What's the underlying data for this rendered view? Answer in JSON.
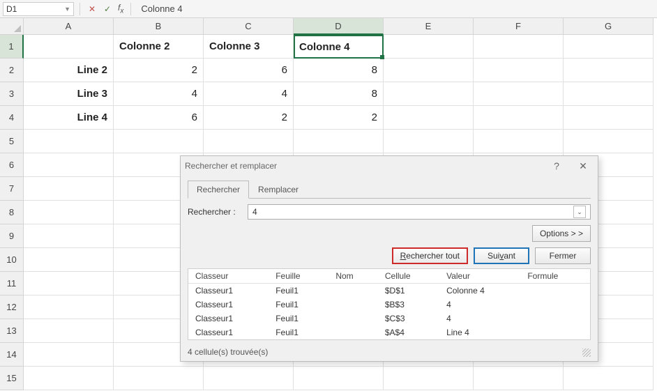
{
  "formula_bar": {
    "name_box": "D1",
    "formula": "Colonne 4"
  },
  "columns": [
    "A",
    "B",
    "C",
    "D",
    "E",
    "F",
    "G"
  ],
  "rows": [
    "1",
    "2",
    "3",
    "4",
    "5",
    "6",
    "7",
    "8",
    "9",
    "10",
    "11",
    "12",
    "13",
    "14",
    "15"
  ],
  "active": {
    "col": "D",
    "row": "1"
  },
  "sheet": {
    "r1": {
      "A": "",
      "B": "Colonne 2",
      "C": "Colonne 3",
      "D": "Colonne 4"
    },
    "r2": {
      "A": "Line 2",
      "B": "2",
      "C": "6",
      "D": "8"
    },
    "r3": {
      "A": "Line 3",
      "B": "4",
      "C": "4",
      "D": "8"
    },
    "r4": {
      "A": "Line 4",
      "B": "6",
      "C": "2",
      "D": "2"
    }
  },
  "dialog": {
    "title": "Rechercher et remplacer",
    "help": "?",
    "close": "✕",
    "tabs": {
      "find": "Rechercher",
      "replace": "Remplacer"
    },
    "label_find": "Rechercher :",
    "find_value": "4",
    "options_btn": "Options > >",
    "btn_find_all": "Rechercher tout",
    "btn_find_next": "Suivant",
    "btn_close": "Fermer",
    "results": {
      "headers": {
        "workbook": "Classeur",
        "sheet": "Feuille",
        "name": "Nom",
        "cell": "Cellule",
        "value": "Valeur",
        "formula": "Formule"
      },
      "rows": [
        {
          "workbook": "Classeur1",
          "sheet": "Feuil1",
          "name": "",
          "cell": "$D$1",
          "value": "Colonne 4",
          "formula": ""
        },
        {
          "workbook": "Classeur1",
          "sheet": "Feuil1",
          "name": "",
          "cell": "$B$3",
          "value": "4",
          "formula": ""
        },
        {
          "workbook": "Classeur1",
          "sheet": "Feuil1",
          "name": "",
          "cell": "$C$3",
          "value": "4",
          "formula": ""
        },
        {
          "workbook": "Classeur1",
          "sheet": "Feuil1",
          "name": "",
          "cell": "$A$4",
          "value": "Line 4",
          "formula": ""
        }
      ]
    },
    "status": "4 cellule(s) trouvée(s)"
  }
}
